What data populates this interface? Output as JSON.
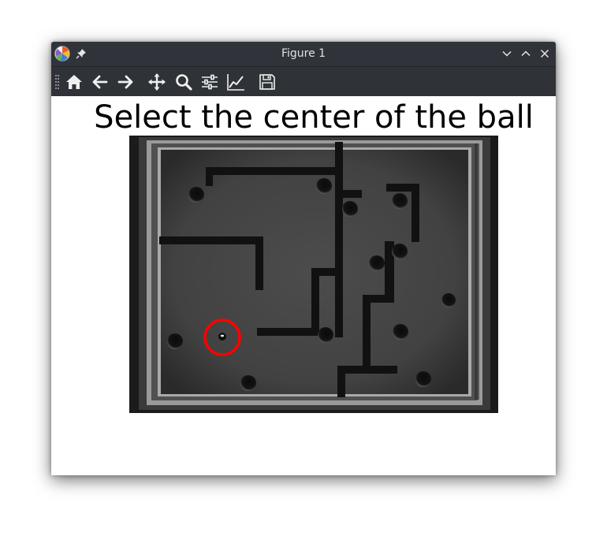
{
  "window": {
    "title": "Figure 1"
  },
  "titlebar_buttons": [
    {
      "name": "minimize-icon"
    },
    {
      "name": "maximize-icon"
    },
    {
      "name": "close-icon"
    }
  ],
  "toolbar": {
    "tools": [
      {
        "name": "home-icon",
        "tooltip": "Reset original view"
      },
      {
        "name": "back-icon",
        "tooltip": "Back to previous view"
      },
      {
        "name": "forward-icon",
        "tooltip": "Forward to next view"
      },
      {
        "name": "pan-icon",
        "tooltip": "Pan axes"
      },
      {
        "name": "zoom-icon",
        "tooltip": "Zoom to rectangle"
      },
      {
        "name": "subplots-icon",
        "tooltip": "Configure subplots"
      },
      {
        "name": "edit-axes-icon",
        "tooltip": "Edit axis, curve and image parameters"
      },
      {
        "name": "save-icon",
        "tooltip": "Save the figure"
      }
    ]
  },
  "figure": {
    "title": "Select the center of the ball",
    "image": {
      "subject": "labyrinth maze board with ball",
      "marker_color": "#ff0000"
    }
  }
}
